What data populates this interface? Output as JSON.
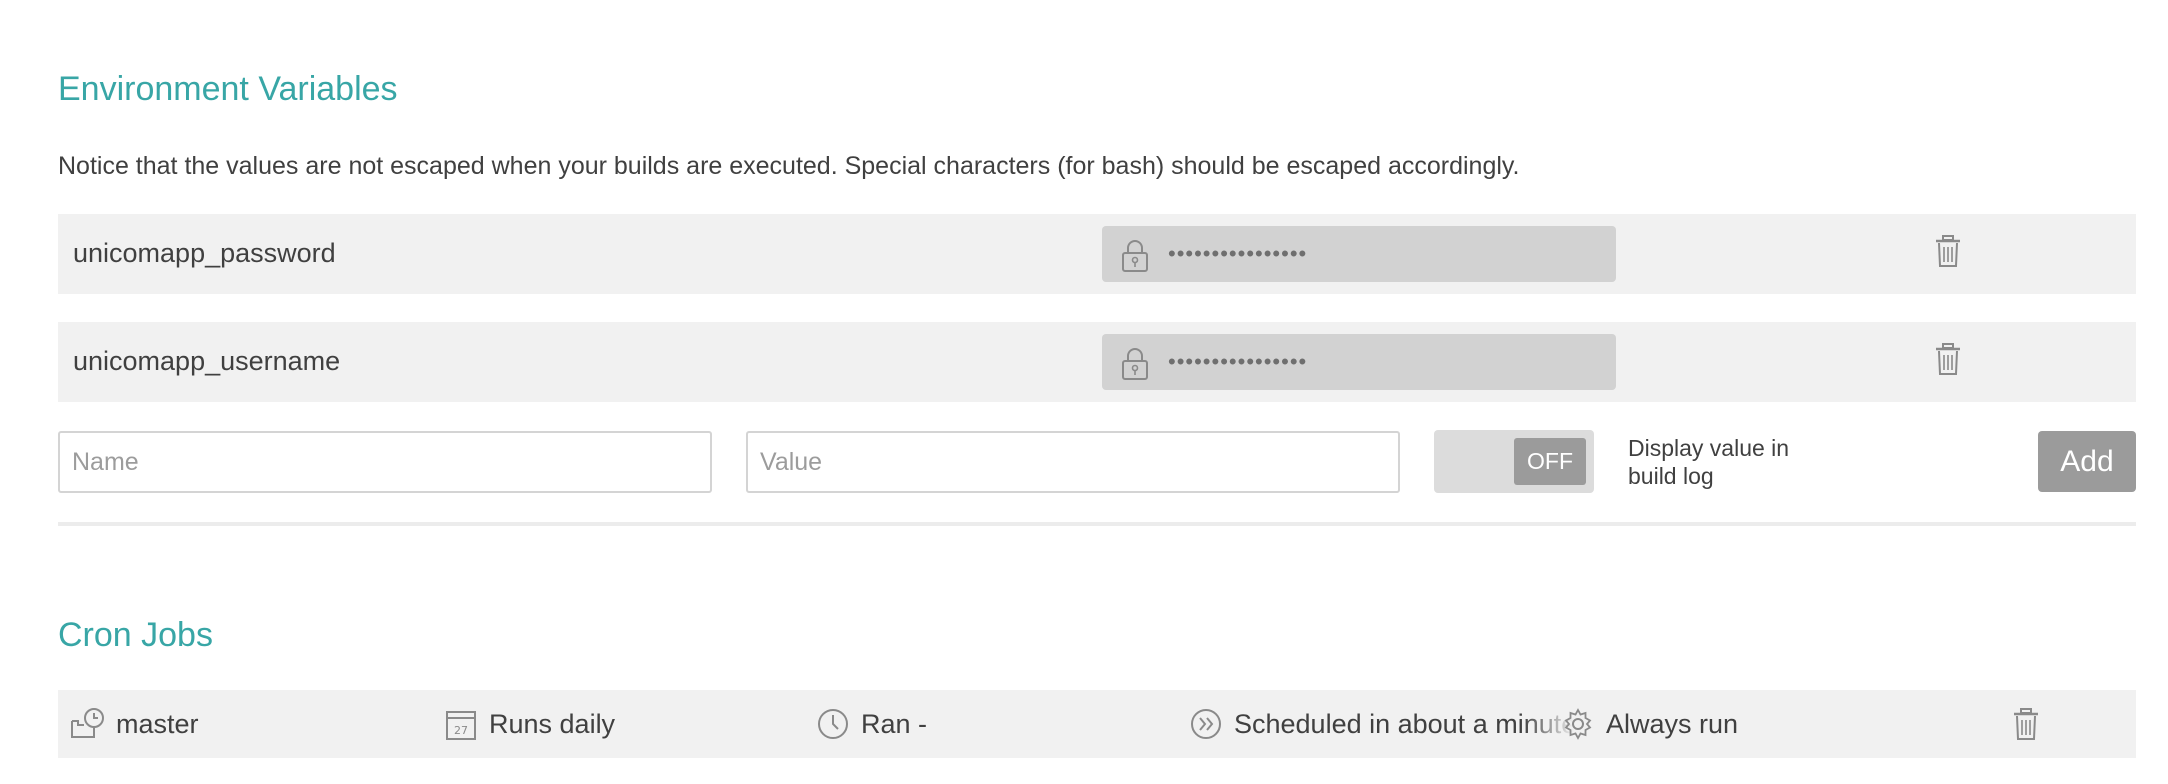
{
  "env": {
    "title": "Environment Variables",
    "notice": "Notice that the values are not escaped when your builds are executed. Special characters (for bash) should be escaped accordingly.",
    "variables": [
      {
        "name": "unicomapp_password",
        "masked_value": "••••••••••••••••"
      },
      {
        "name": "unicomapp_username",
        "masked_value": "••••••••••••••••"
      }
    ],
    "form": {
      "name_placeholder": "Name",
      "value_placeholder": "Value",
      "toggle_label": "OFF",
      "display_label_line1": "Display value in",
      "display_label_line2": "build log",
      "add_label": "Add"
    }
  },
  "cron": {
    "title": "Cron Jobs",
    "job": {
      "branch": "master",
      "interval": "Runs daily",
      "last_run": "Ran -",
      "next_run": "Scheduled in about a minute",
      "condition": "Always run"
    }
  }
}
